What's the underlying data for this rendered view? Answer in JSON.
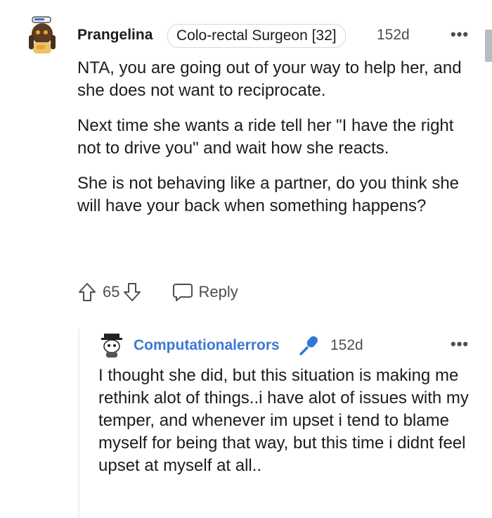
{
  "comment": {
    "username": "Prangelina",
    "flair": "Colo-rectal Surgeon [32]",
    "age": "152d",
    "more": "•••",
    "paragraphs": [
      "NTA, you are going out of your way to help her, and she does not want to reciprocate.",
      "Next time she wants a ride tell her \"I have the right not to drive you\" and wait how she reacts.",
      "She is not behaving like a partner, do you think she will have your back when something happens?"
    ],
    "score": "65",
    "reply_label": "Reply"
  },
  "reply": {
    "username": "Computationalerrors",
    "age": "152d",
    "more": "•••",
    "text": "I thought she did, but this situation is making me rethink alot of things..i have alot of issues with my temper, and whenever im upset i tend to blame myself for being that way, but this time i didnt feel upset at myself at all.."
  },
  "colors": {
    "accent": "#3b7ad4",
    "mic": "#2d7ad6",
    "muted": "#4a4f52"
  },
  "icons": [
    "snoo-avatar-sailor",
    "upvote-icon",
    "downvote-icon",
    "reply-bubble-icon",
    "snoo-avatar-hat",
    "microphone-icon"
  ]
}
